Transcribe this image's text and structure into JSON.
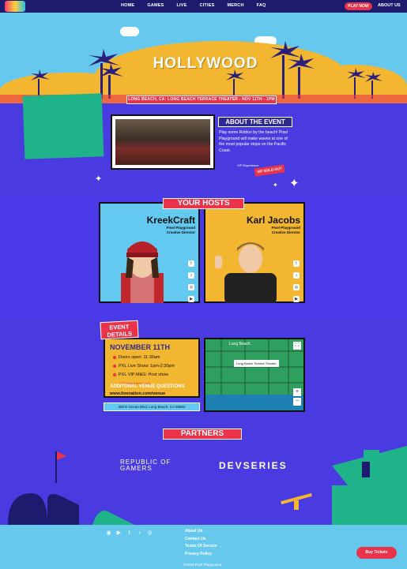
{
  "nav": {
    "links": [
      "HOME",
      "GAMES",
      "LIVE",
      "CITIES",
      "MERCH",
      "FAQ"
    ],
    "play_label": "PLAY NOW",
    "about_label": "ABOUT US"
  },
  "hero": {
    "sign": "HOLLYWOOD",
    "venue_banner": "LONG BEACH, CA: LONG BEACH TERRACE THEATER - NOV 11TH - 1PM"
  },
  "event": {
    "title": "ABOUT THE EVENT",
    "description": "Play some Roblox by the beach! Pixel Playground will make waves at one of the most popular stops on the Pacific Coast.",
    "vip_label": "VIP Experience",
    "sold_out": "VIP SOLD OUT"
  },
  "hosts": {
    "title": "YOUR HOSTS",
    "list": [
      {
        "name": "KreekCraft",
        "role_1": "Pixel Playground",
        "role_2": "Creative Director"
      },
      {
        "name": "Karl Jacobs",
        "role_1": "Pixel Playground",
        "role_2": "Creative Director"
      }
    ]
  },
  "details": {
    "tag_1": "EVENT",
    "tag_2": "DETAILS",
    "date": "NOVEMBER 11TH",
    "rows": [
      "Doors open: 11:30am",
      "PXL Live Show: 1pm-2:30pm",
      "PXL VIP M&G: Post show"
    ],
    "note": "VIP ticket holders only",
    "questions": "ADDITONAL VENUE QUESTIONS",
    "link": "www.livenation.com/venue",
    "address": "300 E Ocean Blvd, Long Beach, CA 90802"
  },
  "map": {
    "city": "Long Beach",
    "pin_label": "Long Beach Terrace Theater",
    "zoom_in": "+",
    "zoom_out": "−"
  },
  "partners": {
    "title": "PARTNERS",
    "rog_line_1": "REPUBLIC OF",
    "rog_line_2": "GAMERS",
    "devseries": "DEVSERIES"
  },
  "footer": {
    "links": [
      "About Us →",
      "Contact Us →",
      "Terms Of Service →",
      "Privacy Policy →"
    ],
    "buy_label": "Buy Tickets",
    "copyright": "©2023 Pixel Playground"
  }
}
